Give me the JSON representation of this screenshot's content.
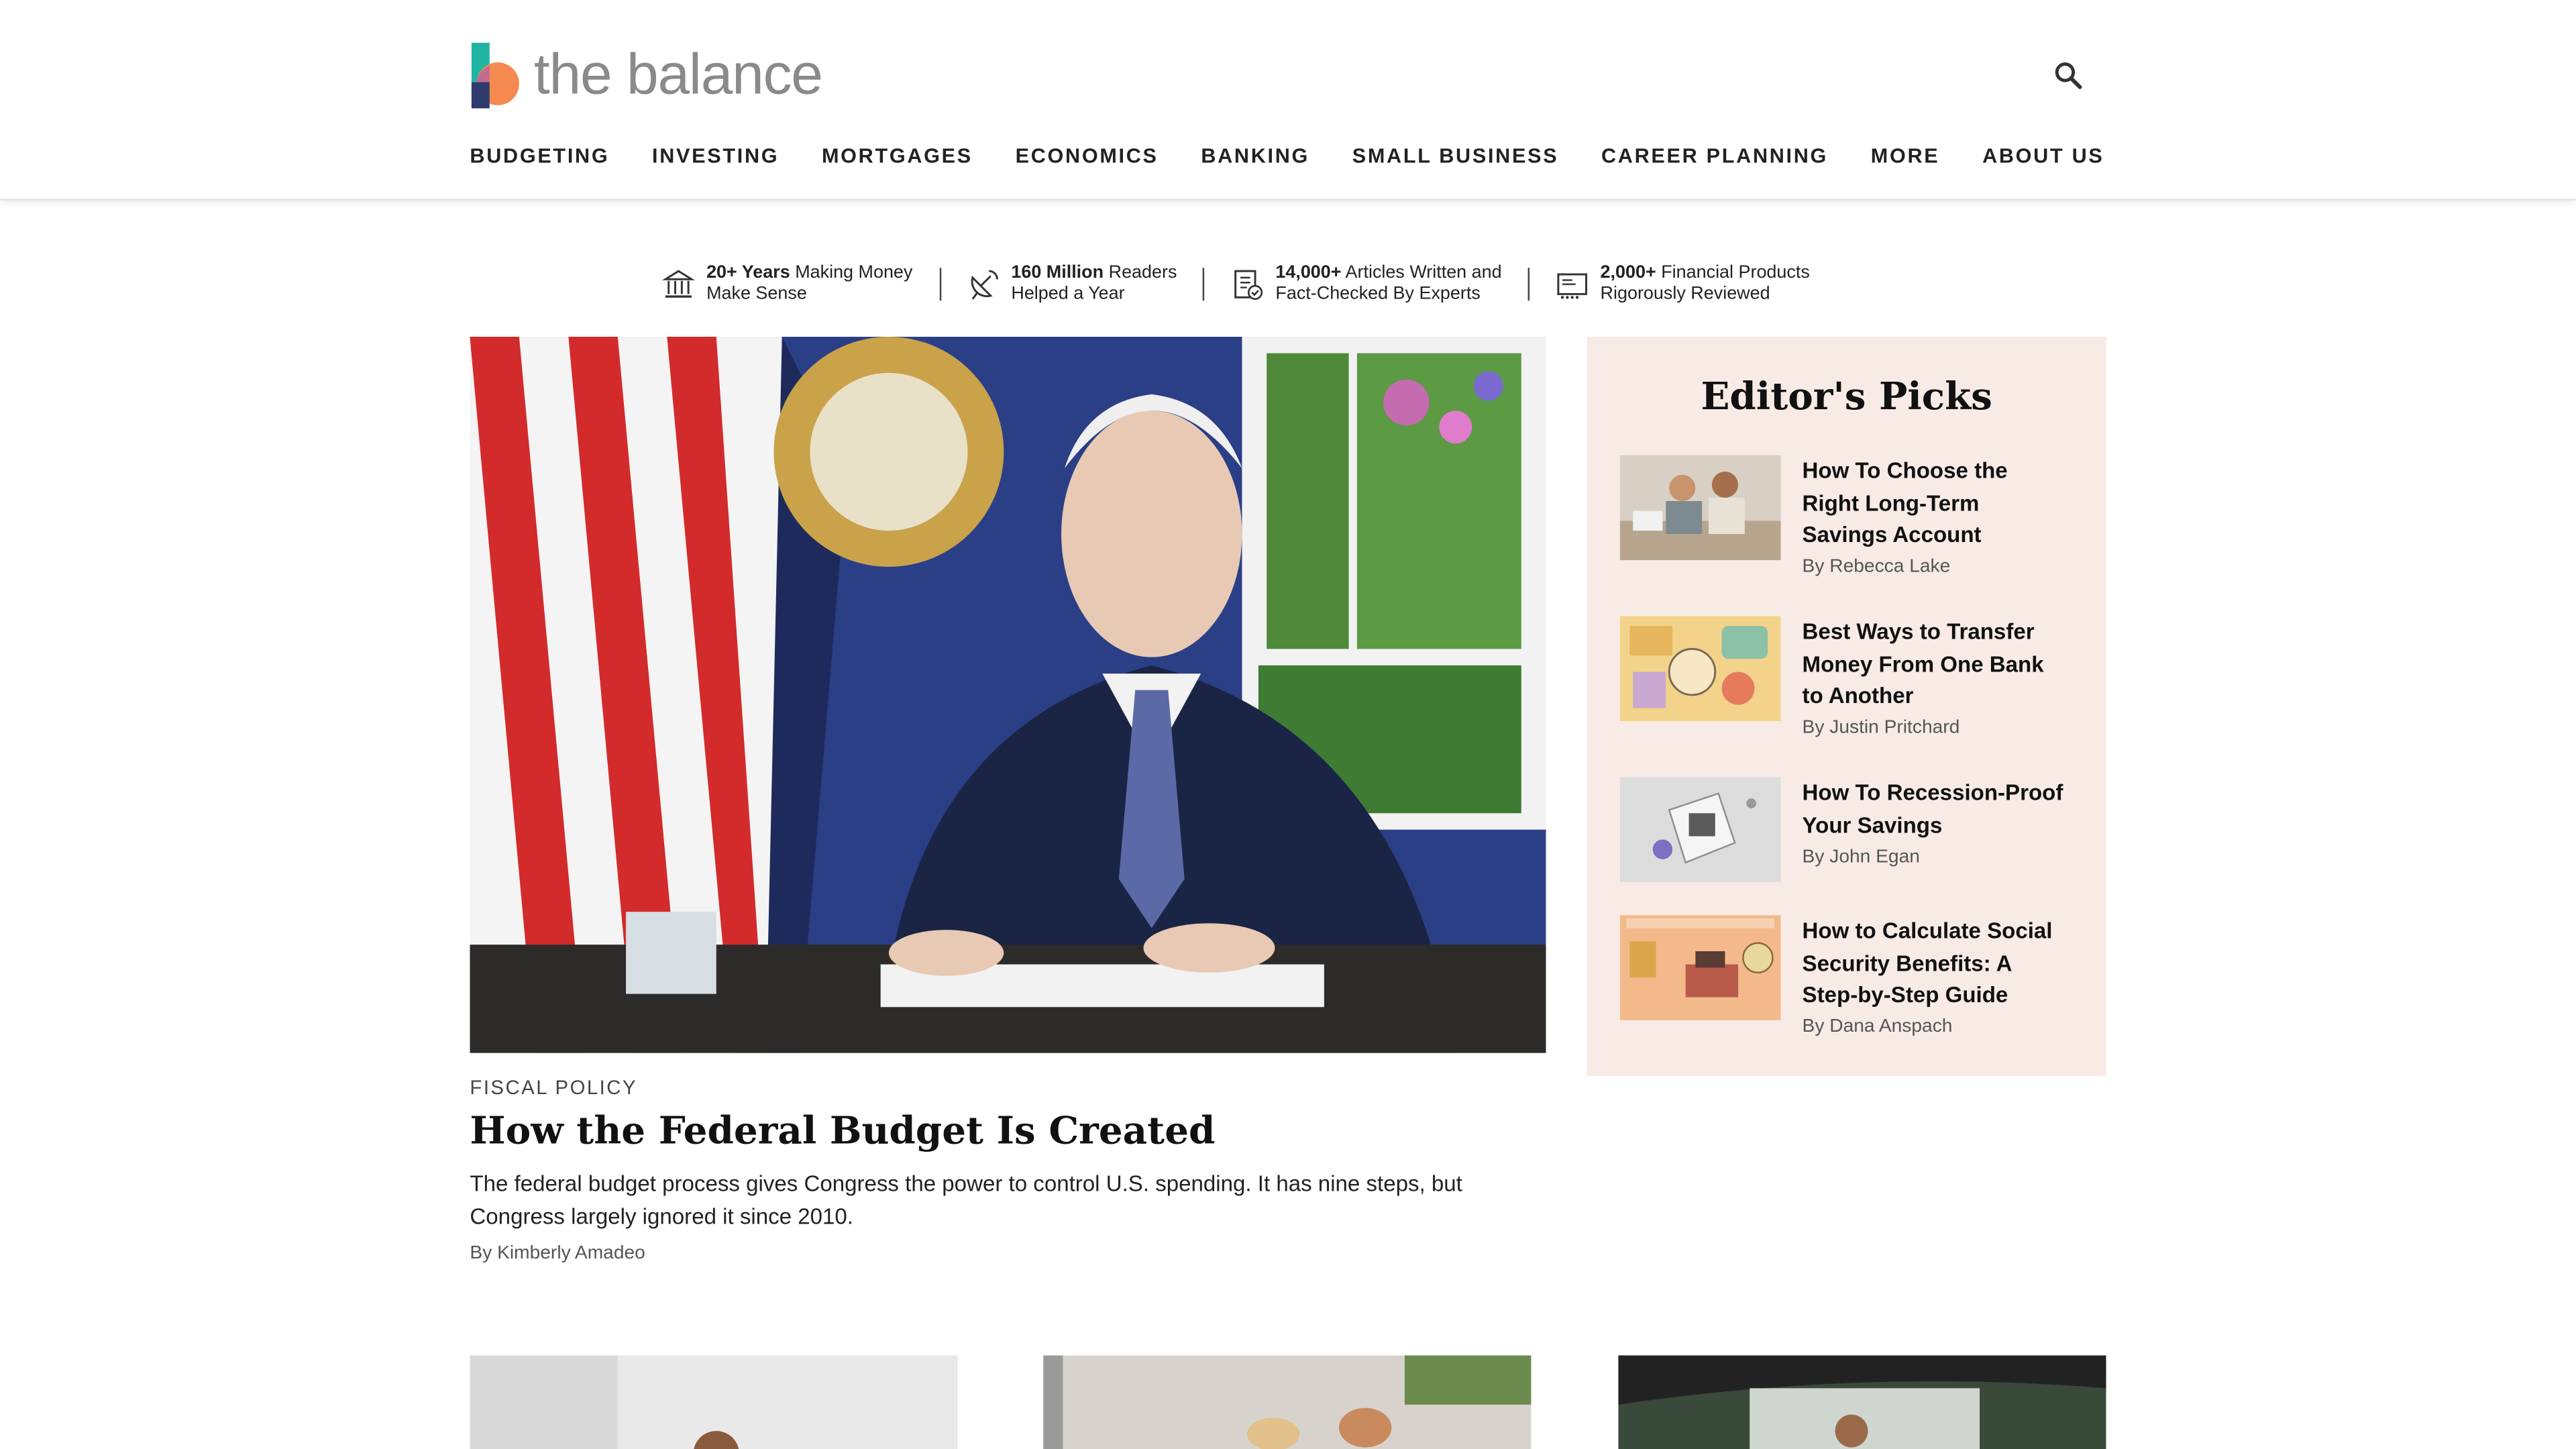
{
  "brand": {
    "name": "the balance"
  },
  "header": {
    "search_icon": "search-icon",
    "nav": [
      "BUDGETING",
      "INVESTING",
      "MORTGAGES",
      "ECONOMICS",
      "BANKING",
      "SMALL BUSINESS",
      "CAREER PLANNING",
      "MORE",
      "ABOUT US"
    ]
  },
  "stats": [
    {
      "icon": "bank-icon",
      "strong": "20+ Years",
      "rest1": "Making Money",
      "line2": "Make Sense"
    },
    {
      "icon": "satellite-dish-icon",
      "strong": "160 Million",
      "rest1": "Readers",
      "line2": "Helped a Year"
    },
    {
      "icon": "document-check-icon",
      "strong": "14,000+",
      "rest1": "Articles Written and",
      "line2": "Fact-Checked By Experts"
    },
    {
      "icon": "card-list-icon",
      "strong": "2,000+",
      "rest1": "Financial Products",
      "line2": "Rigorously Reviewed"
    }
  ],
  "hero": {
    "kicker": "FISCAL POLICY",
    "title": "How the Federal Budget Is Created",
    "description": "The federal budget process gives Congress the power to control U.S. spending. It has nine steps, but Congress largely ignored it since 2010.",
    "byline": "By Kimberly Amadeo"
  },
  "editors_picks": {
    "title": "Editor's Picks",
    "items": [
      {
        "title": "How To Choose the Right Long-Term Savings Account",
        "byline": "By Rebecca Lake"
      },
      {
        "title": "Best Ways to Transfer Money From One Bank to Another",
        "byline": "By Justin Pritchard"
      },
      {
        "title": "How To Recession-Proof Your Savings",
        "byline": "By John Egan"
      },
      {
        "title": "How to Calculate Social Security Benefits: A Step-by-Step Guide",
        "byline": "By Dana Anspach"
      }
    ]
  },
  "colors": {
    "accent_teal": "#1fb5a2",
    "accent_orange": "#f5894f",
    "picks_bg": "#f8ebe6"
  }
}
